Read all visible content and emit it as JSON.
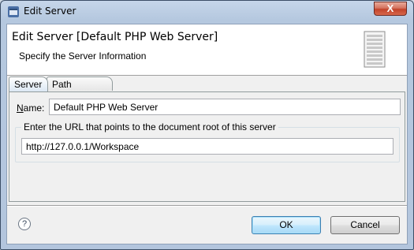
{
  "window": {
    "title": "Edit Server",
    "close_glyph": "X"
  },
  "header": {
    "title": "Edit Server [Default PHP Web Server]",
    "subtitle": "Specify the Server Information"
  },
  "tabs": [
    {
      "label": "Server",
      "active": true
    },
    {
      "label": "Path Mapping",
      "active": false
    }
  ],
  "form": {
    "name_label_prefix": "N",
    "name_label_rest": "ame:",
    "name_value": "Default PHP Web Server",
    "url_group_label": "Enter the URL that points to the document root of this server",
    "url_value": "http://127.0.0.1/Workspace"
  },
  "footer": {
    "help_glyph": "?",
    "ok_label": "OK",
    "cancel_label": "Cancel"
  },
  "icons": [
    "app-icon",
    "close-icon",
    "server-icon",
    "help-icon"
  ]
}
